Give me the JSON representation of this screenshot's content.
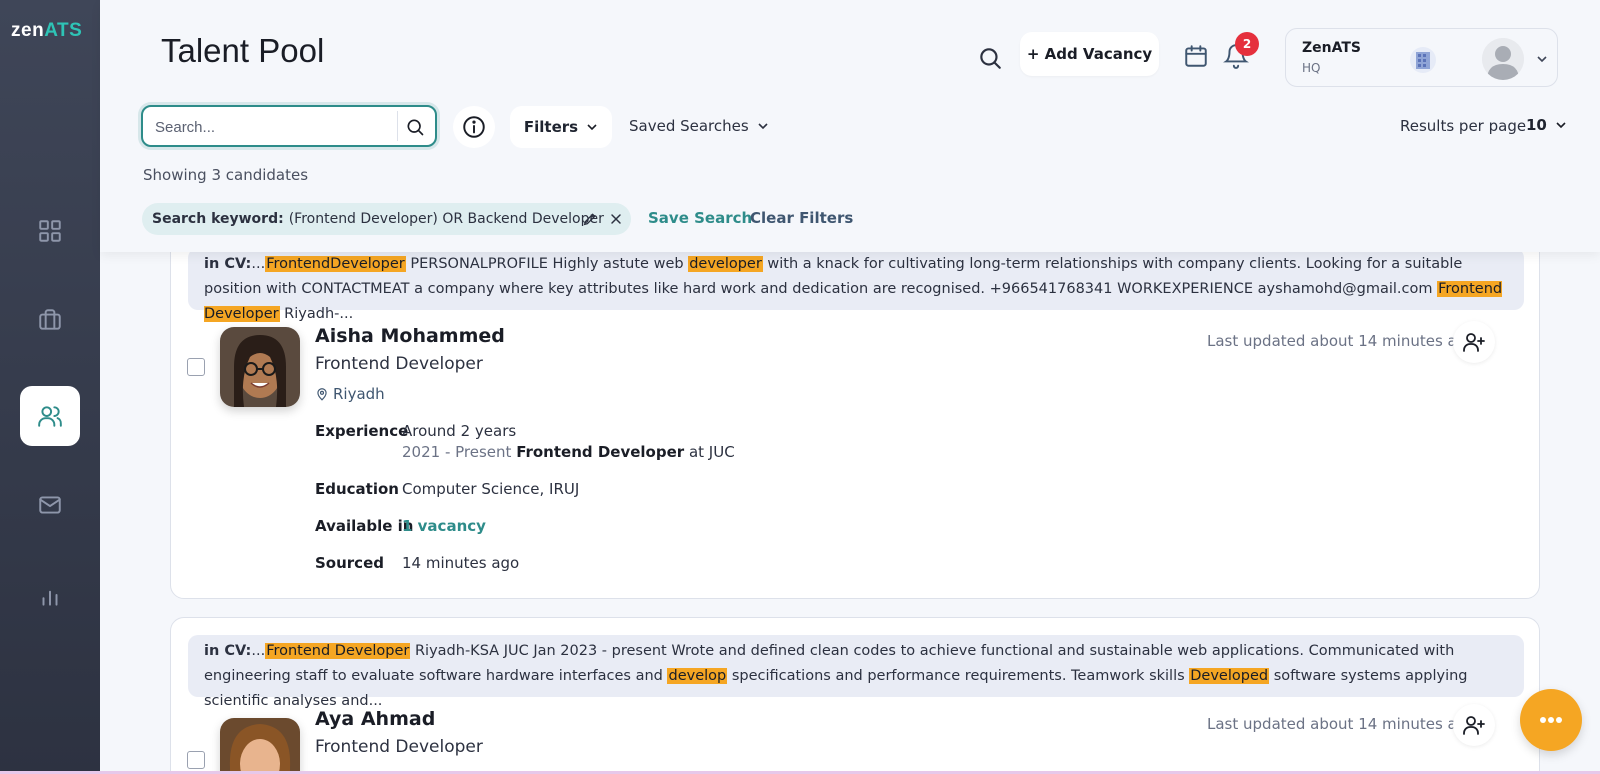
{
  "logo": {
    "zen": "zen",
    "ats": "ATS"
  },
  "sidebar": {
    "items": [
      {
        "name": "dashboard",
        "icon": "grid-icon"
      },
      {
        "name": "vacancies",
        "icon": "briefcase-icon"
      },
      {
        "name": "talent-pool",
        "icon": "users-icon",
        "active": true
      },
      {
        "name": "inbox",
        "icon": "mail-icon"
      },
      {
        "name": "reports",
        "icon": "bar-chart-icon"
      }
    ]
  },
  "header": {
    "title": "Talent Pool",
    "add_vacancy_label": "+ Add Vacancy",
    "notification_count": "2",
    "account": {
      "name": "ZenATS",
      "sub": "HQ"
    }
  },
  "toolbar": {
    "search_placeholder": "Search...",
    "filters_label": "Filters",
    "saved_searches_label": "Saved Searches",
    "results_per_page_label": "Results per page",
    "results_per_page_value": "10",
    "showing_text": "Showing 3 candidates"
  },
  "active_filter": {
    "label": "Search keyword:",
    "value": "(Frontend Developer) OR Backend Developer",
    "save_search_label": "Save Search",
    "clear_filters_label": "Clear Filters"
  },
  "candidates": [
    {
      "snippet": {
        "prefix": "in CV:",
        "parts": [
          "...",
          "FrontendDeveloper",
          " PERSONALPROFILE Highly astute web ",
          "developer",
          " with a knack for cultivating long-term relationships with company clients. Looking for a suitable position with CONTACTMEAT a company where key attributes like hard work and dedication are recognised. +966541768341 WORKEXPERIENCE ayshamohd@gmail.com ",
          "Frontend Developer",
          " Riyadh-..."
        ]
      },
      "name": "Aisha Mohammed",
      "role": "Frontend Developer",
      "location": "Riyadh",
      "updated": "Last updated about 14 minutes ago",
      "experience_label": "Experience",
      "experience_summary": "Around 2 years",
      "experience_period": "2021 - Present",
      "experience_title": "Frontend Developer",
      "experience_company": "at JUC",
      "education_label": "Education",
      "education_value": "Computer Science, IRUJ",
      "available_label": "Available in",
      "available_value": "1 vacancy",
      "sourced_label": "Sourced",
      "sourced_value": "14 minutes ago"
    },
    {
      "snippet": {
        "prefix": "in CV:",
        "parts": [
          "...",
          "Frontend Developer",
          " Riyadh-KSA JUC Jan 2023 - present Wrote and defined clean codes to achieve functional and sustainable web applications. Communicated with engineering staff to evaluate software hardware interfaces and ",
          "develop",
          " specifications and performance requirements. Teamwork skills ",
          "Developed",
          " software systems applying scientific analyses and..."
        ]
      },
      "name": "Aya Ahmad",
      "role": "Frontend Developer",
      "updated": "Last updated about 14 minutes ago"
    }
  ],
  "colors": {
    "accent": "#2e8c8a",
    "highlight": "#f5a623",
    "badge": "#e5303d",
    "sidebar": "#3f4658"
  }
}
